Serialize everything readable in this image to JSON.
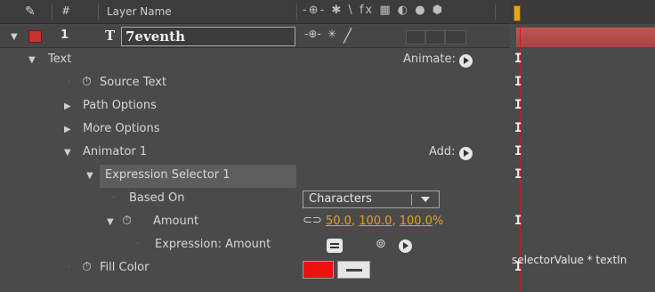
{
  "header": {
    "pen_icon": "pen-icon",
    "hash": "#",
    "layer_name_col": "Layer Name",
    "switches_glyphs": "-⊕- ✱ \\ fx ▦ ◐ ● ⬢"
  },
  "layer": {
    "number": "1",
    "type_glyph": "T",
    "name": "7eventh",
    "label_color": "#c7322e",
    "bar_color": "#b04a4a"
  },
  "properties": [
    {
      "id": "text",
      "label": "Text",
      "right_label": "Animate:"
    },
    {
      "id": "source-text",
      "label": "Source Text"
    },
    {
      "id": "path-options",
      "label": "Path Options"
    },
    {
      "id": "more-options",
      "label": "More Options"
    },
    {
      "id": "animator-1",
      "label": "Animator 1",
      "right_label": "Add:"
    },
    {
      "id": "expression-selector-1",
      "label": "Expression Selector 1"
    },
    {
      "id": "based-on",
      "label": "Based On",
      "value": "Characters"
    },
    {
      "id": "amount",
      "label": "Amount",
      "value_a": "50.0",
      "value_b": ", ",
      "value_c": "100.0",
      "value_d": ", ",
      "value_e": "100.0",
      "value_f": "%"
    },
    {
      "id": "expression-amount",
      "label": "Expression: Amount"
    },
    {
      "id": "fill-color",
      "label": "Fill Color",
      "color": "#ee1010"
    }
  ],
  "timeline": {
    "expression_text": "selectorValue * textIn",
    "keyframe_glyph": "I",
    "cursor_color": "#d01818"
  }
}
